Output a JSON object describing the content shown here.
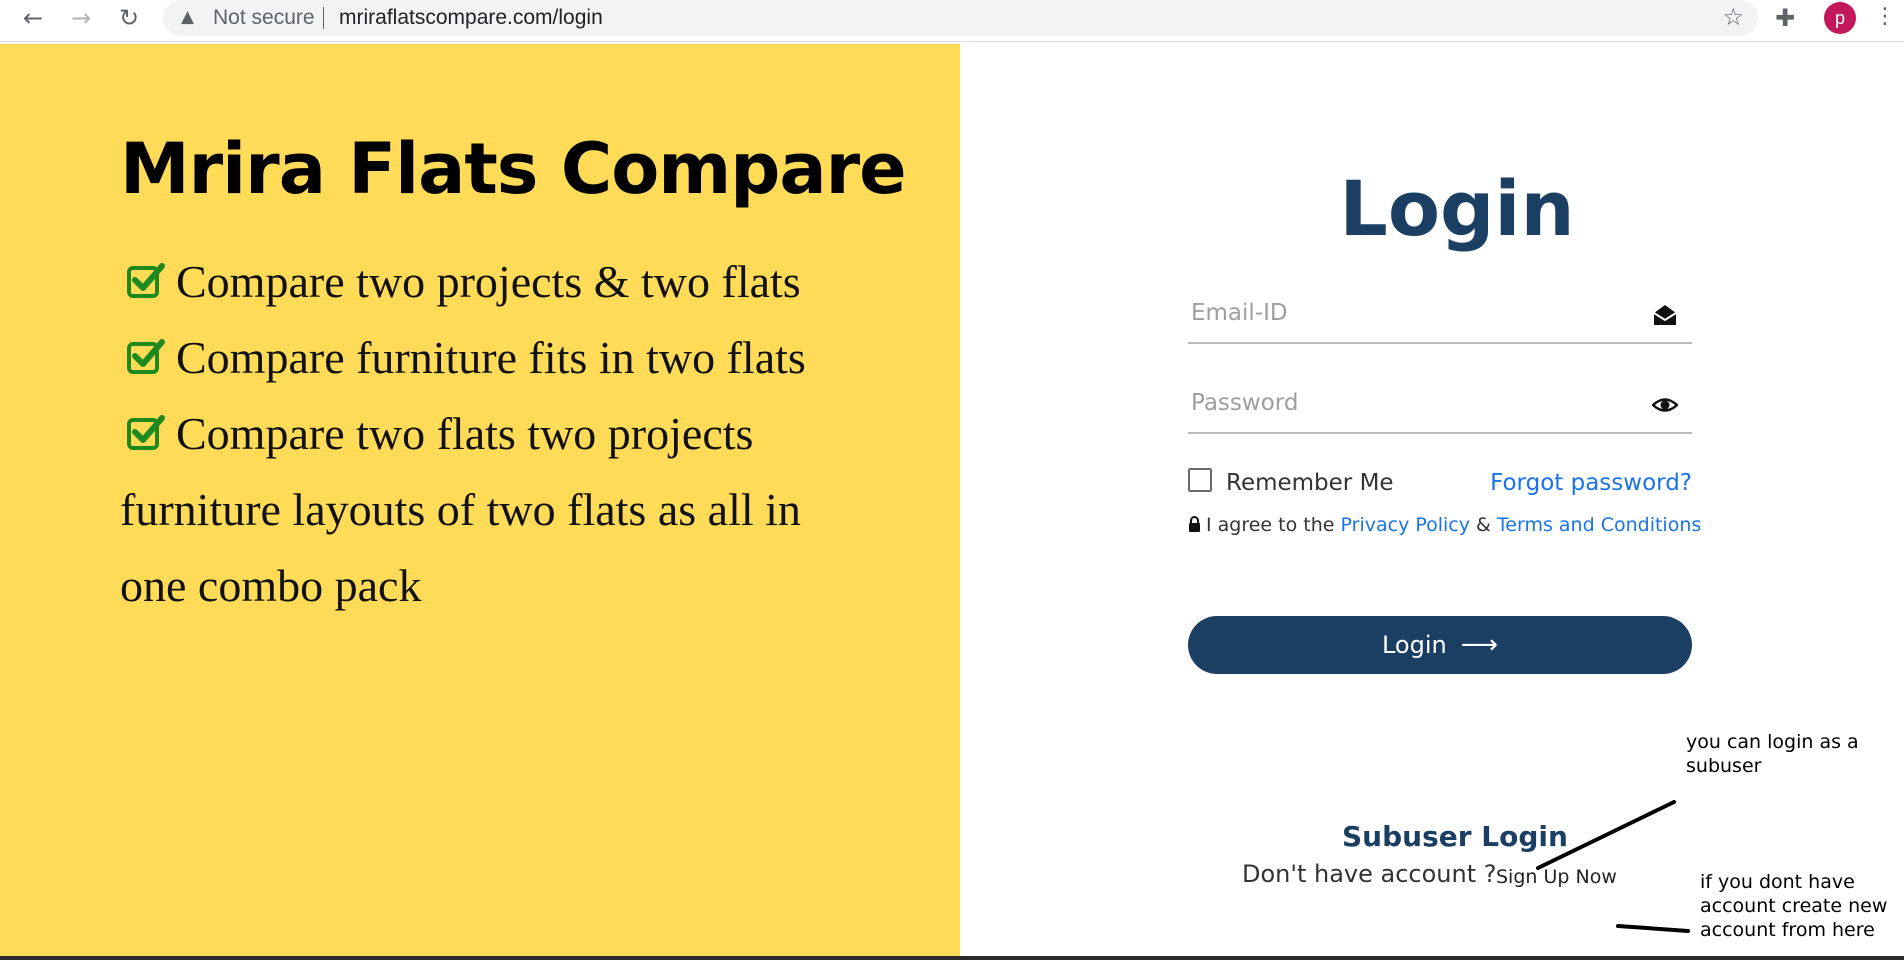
{
  "browser": {
    "security_label": "Not secure",
    "url": "mriraflatscompare.com/login",
    "profile_initial": "p"
  },
  "left": {
    "title": "Mrira Flats Compare",
    "features": [
      "Compare two projects & two flats",
      "Compare furniture fits in two flats",
      "Compare two flats two projects"
    ],
    "continuation_lines": [
      "furniture layouts of two flats as all in",
      "one combo pack"
    ]
  },
  "login": {
    "heading": "Login",
    "email_placeholder": "Email-ID",
    "password_placeholder": "Password",
    "remember_label": "Remember Me",
    "forgot_label": "Forgot password?",
    "agree_prefix": "I agree to the",
    "privacy_label": "Privacy Policy",
    "amp": "&",
    "terms_label": "Terms and Conditions",
    "button_label": "Login",
    "button_arrow": "⟶",
    "subuser_label": "Subuser Login",
    "no_account_label": "Don't have account ?",
    "signup_label": "Sign Up Now"
  },
  "annotations": {
    "subuser_note": "you can login as a subuser",
    "signup_note": "if you dont have account create new account from here"
  },
  "colors": {
    "left_bg": "#ffdb58",
    "brand_navy": "#1b3f63",
    "link_blue": "#1a73e8",
    "check_green": "#1e8a1e"
  }
}
